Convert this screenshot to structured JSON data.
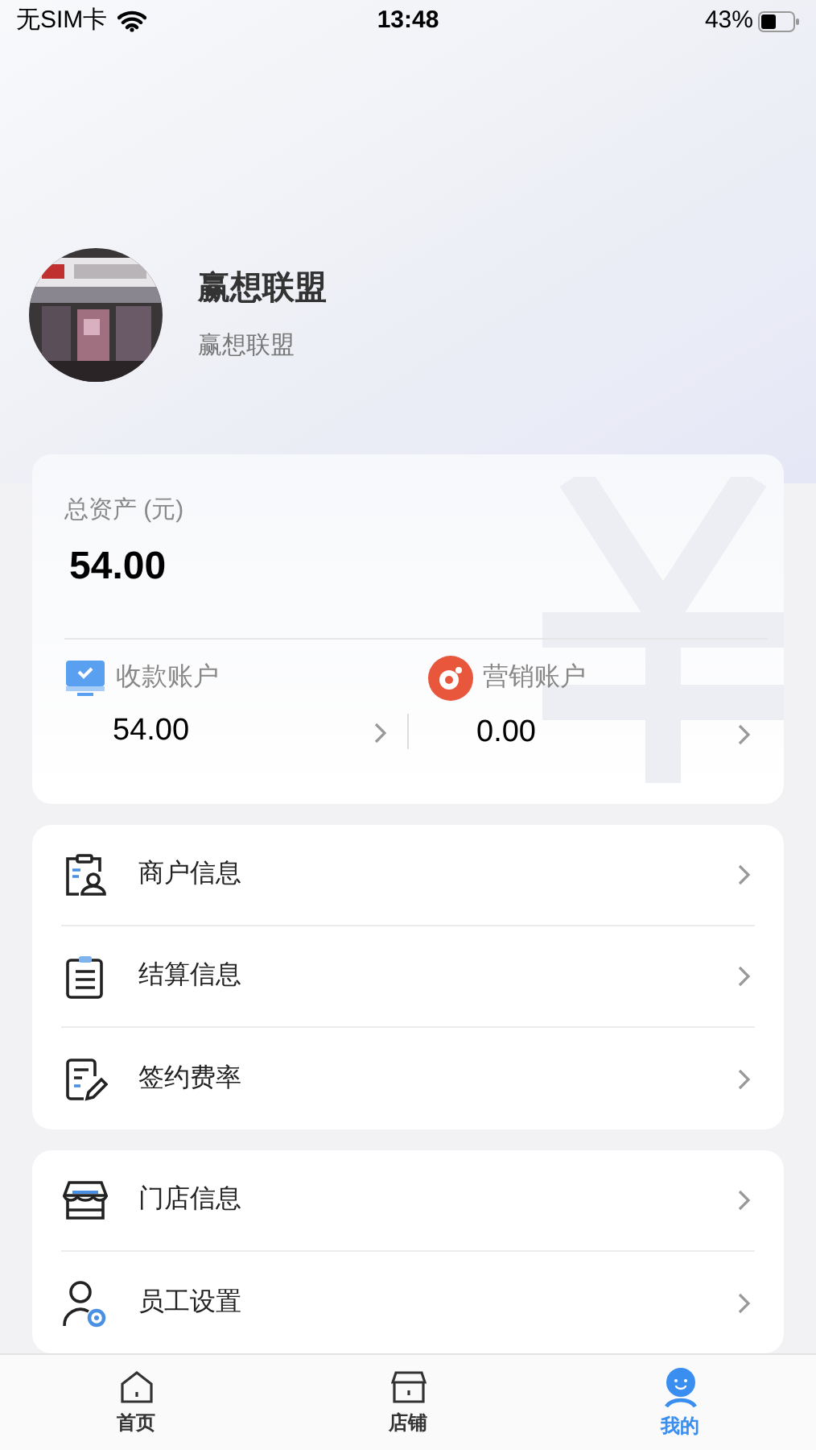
{
  "status_bar": {
    "carrier": "无SIM卡",
    "time": "13:48",
    "battery": "43%"
  },
  "profile": {
    "name": "赢想联盟",
    "subtitle": "赢想联盟"
  },
  "assets": {
    "label": "总资产 (元)",
    "total": "54.00",
    "accounts": [
      {
        "kind": "collection",
        "label": "收款账户",
        "amount": "54.00"
      },
      {
        "kind": "marketing",
        "label": "营销账户",
        "amount": "0.00"
      }
    ]
  },
  "menu_groups": [
    [
      {
        "kind": "merchant",
        "label": "商户信息"
      },
      {
        "kind": "settlement",
        "label": "结算信息"
      },
      {
        "kind": "contract",
        "label": "签约费率"
      }
    ],
    [
      {
        "kind": "store",
        "label": "门店信息"
      },
      {
        "kind": "staff",
        "label": "员工设置"
      }
    ]
  ],
  "tabs": [
    {
      "kind": "home",
      "label": "首页",
      "selected": false
    },
    {
      "kind": "shop",
      "label": "店铺",
      "selected": false
    },
    {
      "kind": "me",
      "label": "我的",
      "selected": true
    }
  ]
}
